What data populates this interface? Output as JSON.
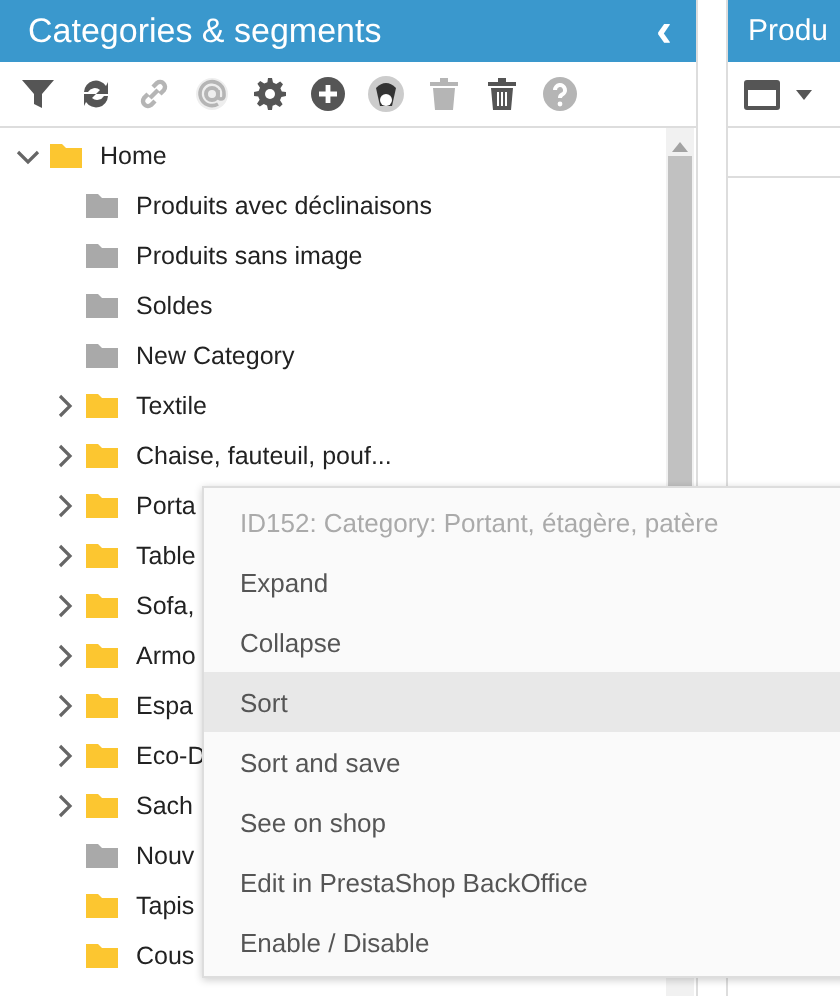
{
  "left_panel": {
    "title": "Categories & segments",
    "collapse_glyph": "‹",
    "toolbar": [
      {
        "kind": "filter",
        "disabled": false
      },
      {
        "kind": "refresh",
        "disabled": false
      },
      {
        "kind": "link",
        "disabled": true
      },
      {
        "kind": "at",
        "disabled": true
      },
      {
        "kind": "gear",
        "disabled": false
      },
      {
        "kind": "plus",
        "disabled": false
      },
      {
        "kind": "avatar"
      },
      {
        "kind": "trash",
        "disabled": true
      },
      {
        "kind": "trash-bin",
        "disabled": false
      },
      {
        "kind": "help",
        "disabled": true
      }
    ],
    "tree": [
      {
        "label": "Home",
        "enabled": true,
        "expanded": true,
        "children": [
          {
            "label": "Produits avec déclinaisons",
            "enabled": false
          },
          {
            "label": "Produits sans image",
            "enabled": false
          },
          {
            "label": "Soldes",
            "enabled": false
          },
          {
            "label": "New Category",
            "enabled": false
          },
          {
            "label": "Textile",
            "enabled": true,
            "expanded": false
          },
          {
            "label": "Chaise, fauteuil, pouf...",
            "enabled": true,
            "expanded": false
          },
          {
            "label": "Porta",
            "enabled": true,
            "expanded": false
          },
          {
            "label": "Table",
            "enabled": true,
            "expanded": false
          },
          {
            "label": "Sofa,",
            "enabled": true,
            "expanded": false
          },
          {
            "label": "Armo",
            "enabled": true,
            "expanded": false
          },
          {
            "label": "Espa",
            "enabled": true,
            "expanded": false
          },
          {
            "label": "Eco-D",
            "enabled": true,
            "expanded": false
          },
          {
            "label": "Sach",
            "enabled": true,
            "expanded": false
          },
          {
            "label": "Nouv",
            "enabled": false
          },
          {
            "label": "Tapis",
            "enabled": true
          },
          {
            "label": "Cous",
            "enabled": true
          }
        ]
      }
    ]
  },
  "right_panel": {
    "title": "Produ"
  },
  "context_menu": {
    "title": "ID152: Category: Portant, étagère, patère",
    "items": [
      {
        "label": "Expand",
        "selected": false
      },
      {
        "label": "Collapse",
        "selected": false
      },
      {
        "label": "Sort",
        "selected": true
      },
      {
        "label": "Sort and save",
        "selected": false
      },
      {
        "label": "See on shop",
        "selected": false
      },
      {
        "label": "Edit in PrestaShop BackOffice",
        "selected": false
      },
      {
        "label": "Enable / Disable",
        "selected": false
      }
    ]
  }
}
